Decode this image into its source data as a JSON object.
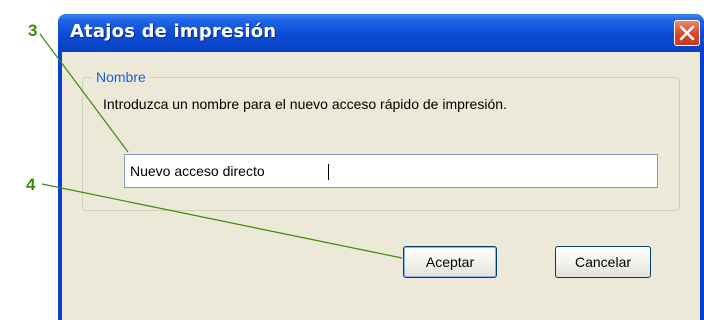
{
  "callouts": {
    "first": "3",
    "second": "4"
  },
  "dialog": {
    "title": "Atajos de impresión",
    "group_label": "Nombre",
    "instruction": "Introduzca un nombre para el nuevo acceso rápido de impresión.",
    "name_input_value": "Nuevo acceso directo",
    "ok_label": "Aceptar",
    "cancel_label": "Cancelar"
  },
  "colors": {
    "titlebar": "#0c4bd6",
    "client_background": "#ece9d8",
    "callout": "#3d8a0c",
    "close_button": "#d8472a",
    "group_label": "#1d5ed6"
  },
  "icons": {
    "close": "close-x-icon"
  }
}
